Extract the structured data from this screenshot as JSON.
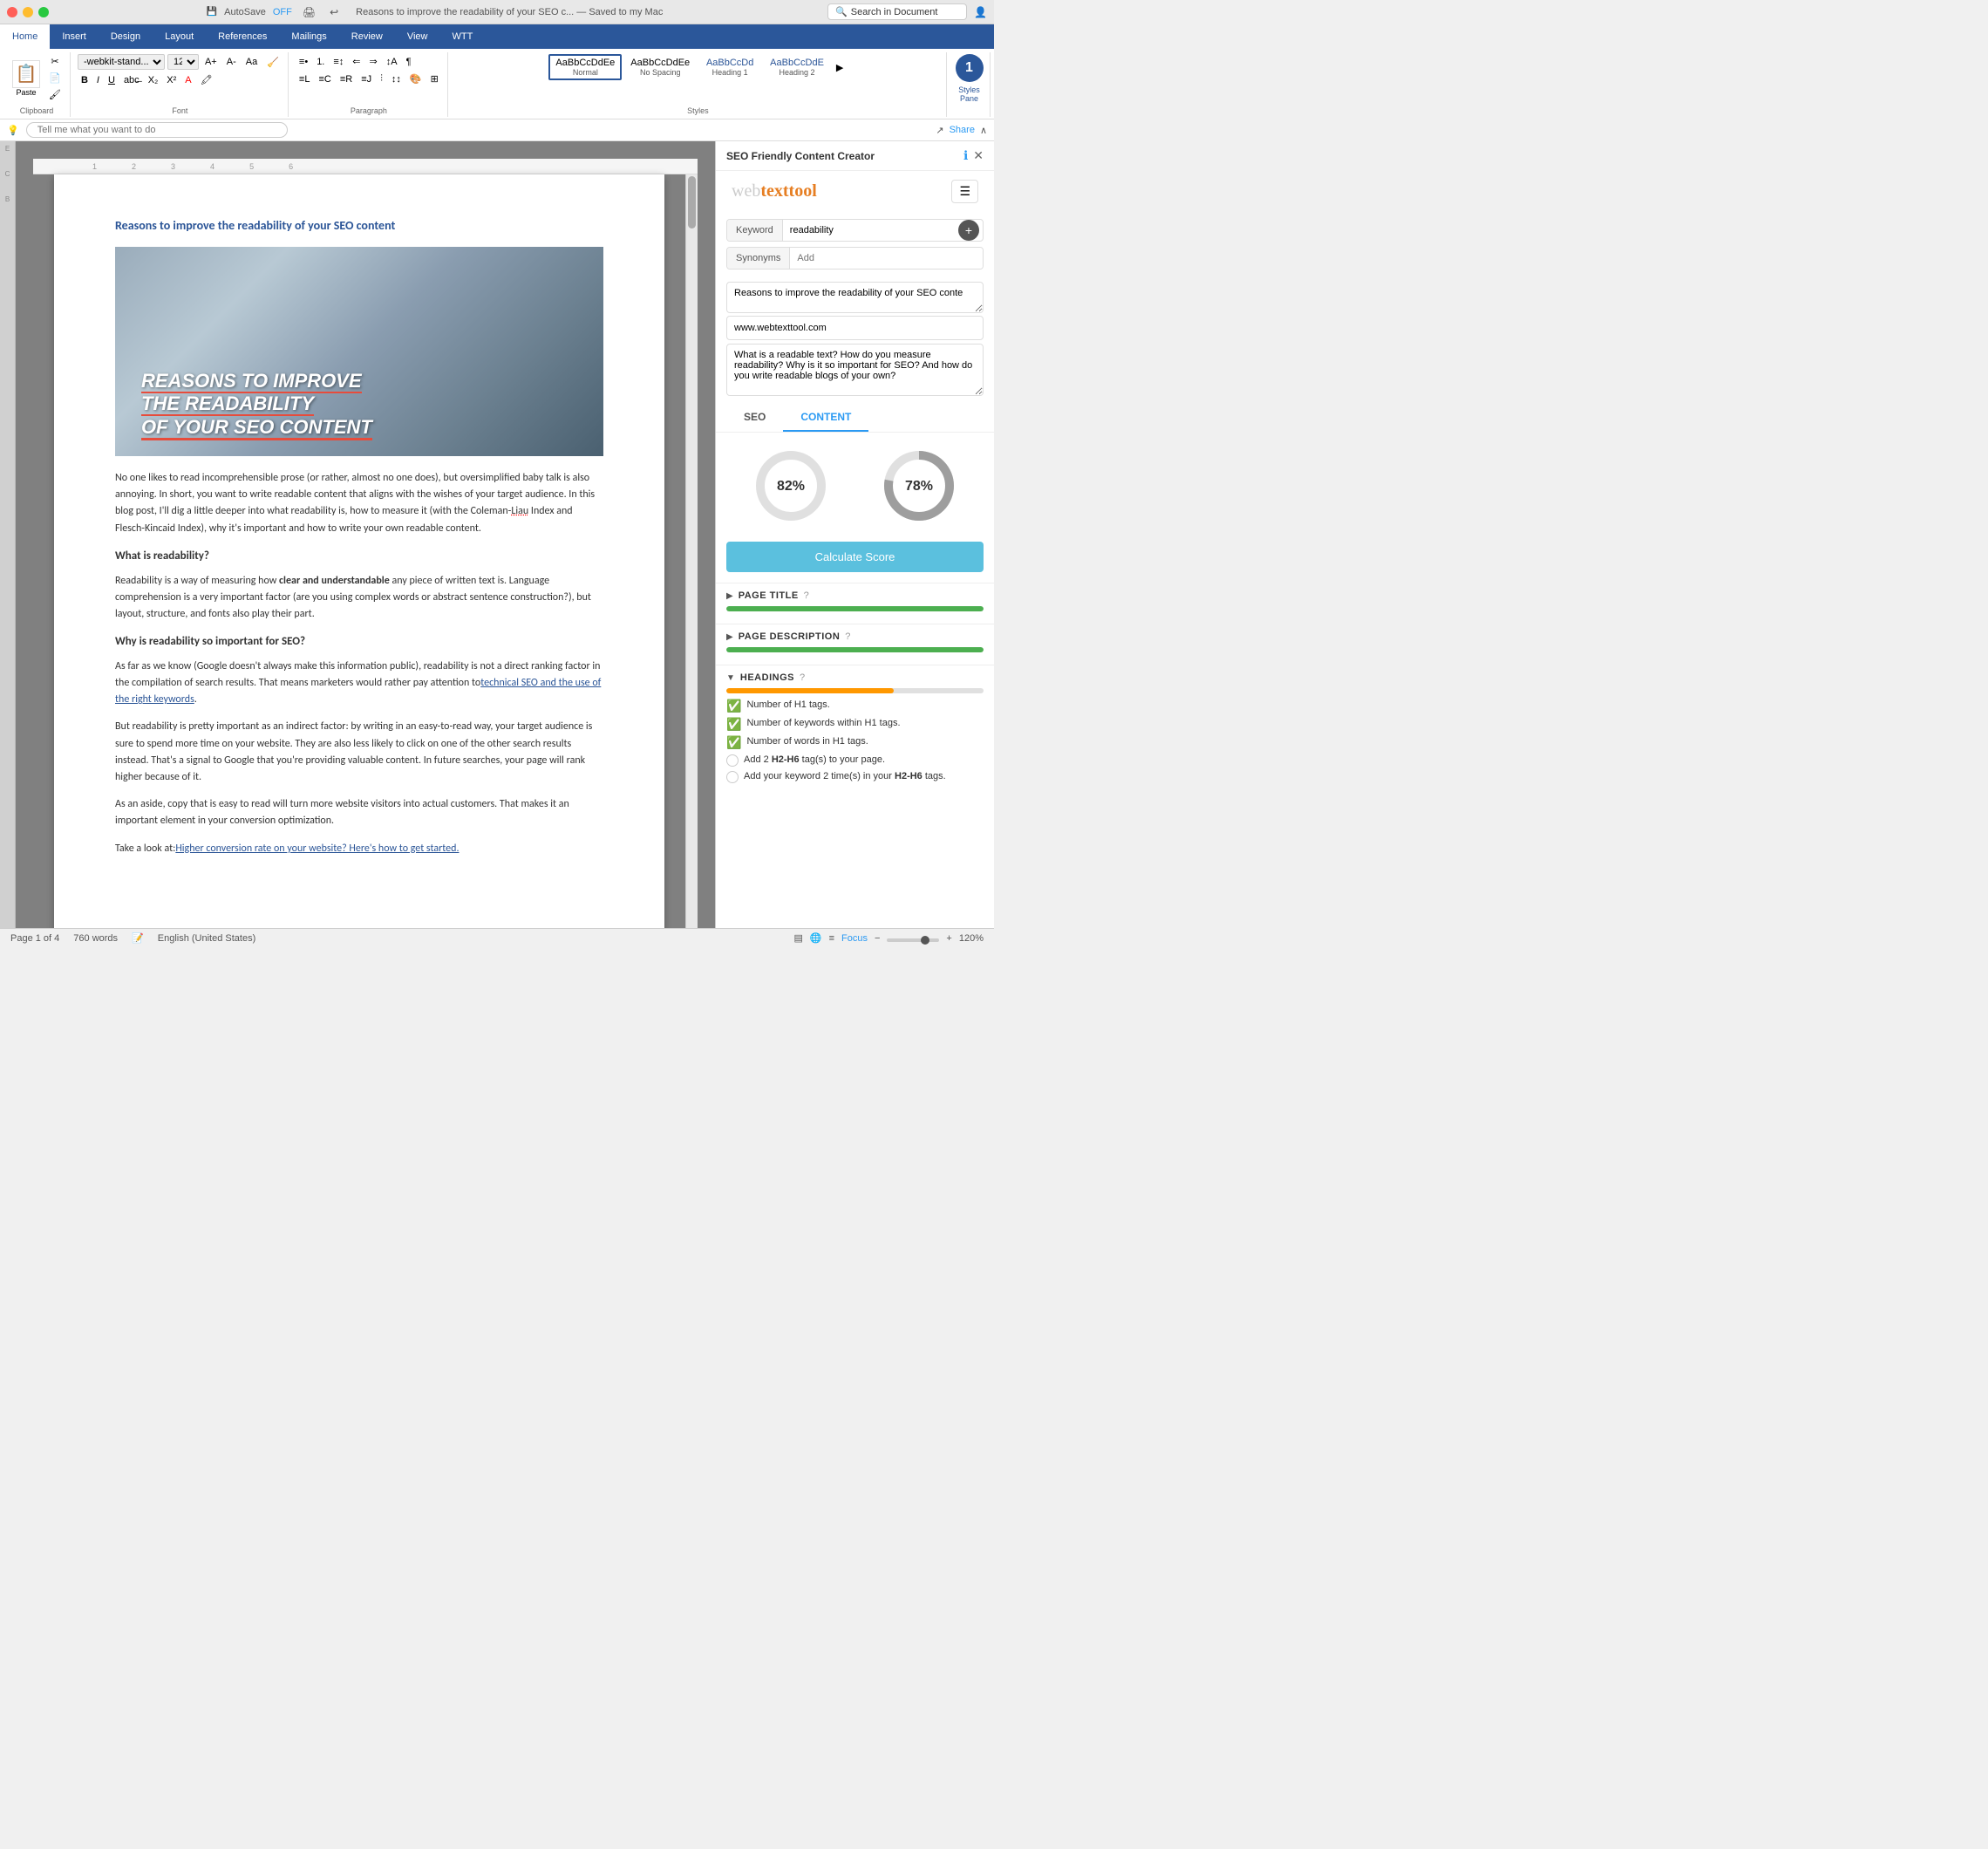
{
  "window": {
    "title": "Reasons to improve the readability of your SEO c... — Saved to my Mac",
    "saved_status": "Saved to my Mac",
    "autosave_label": "AutoSave",
    "autosave_state": "OFF"
  },
  "search": {
    "placeholder": "Search in Document"
  },
  "ribbon": {
    "tabs": [
      "Home",
      "Insert",
      "Design",
      "Layout",
      "References",
      "Mailings",
      "Review",
      "View",
      "WTT"
    ],
    "active_tab": "Home",
    "font_name": "-webkit-stand...",
    "font_size": "12",
    "paste_label": "Paste",
    "styles": [
      {
        "name": "Normal",
        "label": "AaBbCcDdEe",
        "active": true
      },
      {
        "name": "No Spacing",
        "label": "AaBbCcDdEe"
      },
      {
        "name": "Heading 1",
        "label": "AaBbCcDd"
      },
      {
        "name": "Heading 2",
        "label": "AaBbCcDdE"
      }
    ],
    "styles_pane_label": "Styles\nPane"
  },
  "tell_me": {
    "placeholder": "Tell me what you want to do",
    "share_label": "Share"
  },
  "document": {
    "title": "Reasons to improve the readability of your SEO content",
    "image_text_line1": "REASONS TO IMPROVE",
    "image_text_line2": "THE READABILITY",
    "image_text_line3": "OF YOUR SEO CONTENT",
    "paragraphs": [
      "No one likes to read incomprehensible prose (or rather, almost no one does), but oversimplified baby talk is also annoying. In short, you want to write readable content that aligns with the wishes of your target audience. In this blog post, I'll dig a little deeper into what readability is, how to measure it (with the Coleman-Liau Index and Flesch-Kincaid Index), why it's important and how to write your own readable content.",
      "What is readability?",
      "Readability is a way of measuring how clear and understandable any piece of written text is. Language comprehension is a very important factor (are you using complex words or abstract sentence construction?), but layout, structure, and fonts also play their part.",
      "Why is readability so important for SEO?",
      "As far as we know (Google doesn't always make this information public), readability is not a direct ranking factor in the compilation of search results. That means marketers would rather pay attention to technical SEO and the use of the right keywords.",
      "But readability is pretty important as an indirect factor: by writing in an easy-to-read way, your target audience is sure to spend more time on your website. They are also less likely to click on one of the other search results instead. That's a signal to Google that you're providing valuable content. In future searches, your page will rank higher because of it.",
      "As an aside, copy that is easy to read will turn more website visitors into actual customers. That makes it an important element in your conversion optimization.",
      "Take a look at: Higher conversion rate on your website? Here's how to get started."
    ],
    "link_text": "technical SEO and the use of the right keywords",
    "link_text2": "Higher conversion rate on your website? Here's how to get started."
  },
  "sidebar": {
    "title": "SEO Friendly Content Creator",
    "logo_web": "web",
    "logo_text": "text",
    "logo_tool": "tool",
    "keyword_label": "Keyword",
    "keyword_value": "readability",
    "synonyms_label": "Synonyms",
    "synonyms_placeholder": "Add",
    "title_input": "Reasons to improve the readability of your SEO conte",
    "url_input": "www.webtexttool.com",
    "description_input": "What is a readable text? How do you measure readability? Why is it so important for SEO? And how do you write readable blogs of your own?",
    "tabs": [
      "SEO",
      "CONTENT"
    ],
    "active_tab": "CONTENT",
    "seo_score": 82,
    "content_score": 78,
    "calculate_btn": "Calculate Score",
    "sections": [
      {
        "id": "page-title",
        "title": "PAGE TITLE",
        "expanded": false,
        "progress": 100,
        "progress_color": "green"
      },
      {
        "id": "page-description",
        "title": "PAGE DESCRIPTION",
        "expanded": false,
        "progress": 100,
        "progress_color": "green"
      },
      {
        "id": "headings",
        "title": "HEADINGS",
        "expanded": true,
        "progress": 65,
        "progress_color": "orange",
        "checks": [
          {
            "type": "green",
            "text": "Number of H1 tags."
          },
          {
            "type": "green",
            "text": "Number of keywords within H1 tags."
          },
          {
            "type": "green",
            "text": "Number of words in H1 tags."
          },
          {
            "type": "empty",
            "text": "Add 2 H2-H6 tag(s) to your page."
          },
          {
            "type": "empty",
            "text": "Add your keyword 2 time(s) in your H2-H6 tags."
          }
        ]
      }
    ]
  },
  "status_bar": {
    "page_info": "Page 1 of 4",
    "word_count": "760 words",
    "language": "English (United States)",
    "focus_label": "Focus",
    "zoom": "120%"
  }
}
